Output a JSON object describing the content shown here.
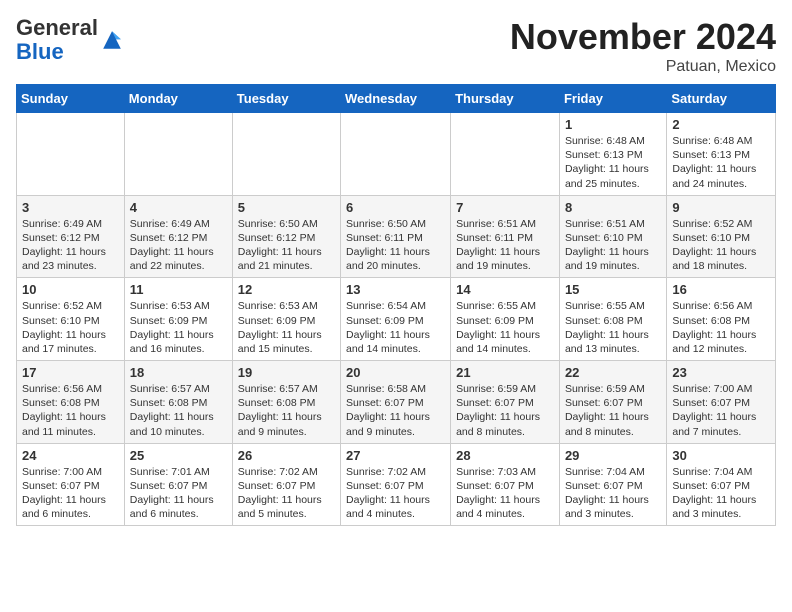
{
  "header": {
    "logo_general": "General",
    "logo_blue": "Blue",
    "month_title": "November 2024",
    "location": "Patuan, Mexico"
  },
  "days_of_week": [
    "Sunday",
    "Monday",
    "Tuesday",
    "Wednesday",
    "Thursday",
    "Friday",
    "Saturday"
  ],
  "weeks": [
    [
      {
        "day": "",
        "content": ""
      },
      {
        "day": "",
        "content": ""
      },
      {
        "day": "",
        "content": ""
      },
      {
        "day": "",
        "content": ""
      },
      {
        "day": "",
        "content": ""
      },
      {
        "day": "1",
        "content": "Sunrise: 6:48 AM\nSunset: 6:13 PM\nDaylight: 11 hours and 25 minutes."
      },
      {
        "day": "2",
        "content": "Sunrise: 6:48 AM\nSunset: 6:13 PM\nDaylight: 11 hours and 24 minutes."
      }
    ],
    [
      {
        "day": "3",
        "content": "Sunrise: 6:49 AM\nSunset: 6:12 PM\nDaylight: 11 hours and 23 minutes."
      },
      {
        "day": "4",
        "content": "Sunrise: 6:49 AM\nSunset: 6:12 PM\nDaylight: 11 hours and 22 minutes."
      },
      {
        "day": "5",
        "content": "Sunrise: 6:50 AM\nSunset: 6:12 PM\nDaylight: 11 hours and 21 minutes."
      },
      {
        "day": "6",
        "content": "Sunrise: 6:50 AM\nSunset: 6:11 PM\nDaylight: 11 hours and 20 minutes."
      },
      {
        "day": "7",
        "content": "Sunrise: 6:51 AM\nSunset: 6:11 PM\nDaylight: 11 hours and 19 minutes."
      },
      {
        "day": "8",
        "content": "Sunrise: 6:51 AM\nSunset: 6:10 PM\nDaylight: 11 hours and 19 minutes."
      },
      {
        "day": "9",
        "content": "Sunrise: 6:52 AM\nSunset: 6:10 PM\nDaylight: 11 hours and 18 minutes."
      }
    ],
    [
      {
        "day": "10",
        "content": "Sunrise: 6:52 AM\nSunset: 6:10 PM\nDaylight: 11 hours and 17 minutes."
      },
      {
        "day": "11",
        "content": "Sunrise: 6:53 AM\nSunset: 6:09 PM\nDaylight: 11 hours and 16 minutes."
      },
      {
        "day": "12",
        "content": "Sunrise: 6:53 AM\nSunset: 6:09 PM\nDaylight: 11 hours and 15 minutes."
      },
      {
        "day": "13",
        "content": "Sunrise: 6:54 AM\nSunset: 6:09 PM\nDaylight: 11 hours and 14 minutes."
      },
      {
        "day": "14",
        "content": "Sunrise: 6:55 AM\nSunset: 6:09 PM\nDaylight: 11 hours and 14 minutes."
      },
      {
        "day": "15",
        "content": "Sunrise: 6:55 AM\nSunset: 6:08 PM\nDaylight: 11 hours and 13 minutes."
      },
      {
        "day": "16",
        "content": "Sunrise: 6:56 AM\nSunset: 6:08 PM\nDaylight: 11 hours and 12 minutes."
      }
    ],
    [
      {
        "day": "17",
        "content": "Sunrise: 6:56 AM\nSunset: 6:08 PM\nDaylight: 11 hours and 11 minutes."
      },
      {
        "day": "18",
        "content": "Sunrise: 6:57 AM\nSunset: 6:08 PM\nDaylight: 11 hours and 10 minutes."
      },
      {
        "day": "19",
        "content": "Sunrise: 6:57 AM\nSunset: 6:08 PM\nDaylight: 11 hours and 9 minutes."
      },
      {
        "day": "20",
        "content": "Sunrise: 6:58 AM\nSunset: 6:07 PM\nDaylight: 11 hours and 9 minutes."
      },
      {
        "day": "21",
        "content": "Sunrise: 6:59 AM\nSunset: 6:07 PM\nDaylight: 11 hours and 8 minutes."
      },
      {
        "day": "22",
        "content": "Sunrise: 6:59 AM\nSunset: 6:07 PM\nDaylight: 11 hours and 8 minutes."
      },
      {
        "day": "23",
        "content": "Sunrise: 7:00 AM\nSunset: 6:07 PM\nDaylight: 11 hours and 7 minutes."
      }
    ],
    [
      {
        "day": "24",
        "content": "Sunrise: 7:00 AM\nSunset: 6:07 PM\nDaylight: 11 hours and 6 minutes."
      },
      {
        "day": "25",
        "content": "Sunrise: 7:01 AM\nSunset: 6:07 PM\nDaylight: 11 hours and 6 minutes."
      },
      {
        "day": "26",
        "content": "Sunrise: 7:02 AM\nSunset: 6:07 PM\nDaylight: 11 hours and 5 minutes."
      },
      {
        "day": "27",
        "content": "Sunrise: 7:02 AM\nSunset: 6:07 PM\nDaylight: 11 hours and 4 minutes."
      },
      {
        "day": "28",
        "content": "Sunrise: 7:03 AM\nSunset: 6:07 PM\nDaylight: 11 hours and 4 minutes."
      },
      {
        "day": "29",
        "content": "Sunrise: 7:04 AM\nSunset: 6:07 PM\nDaylight: 11 hours and 3 minutes."
      },
      {
        "day": "30",
        "content": "Sunrise: 7:04 AM\nSunset: 6:07 PM\nDaylight: 11 hours and 3 minutes."
      }
    ]
  ]
}
